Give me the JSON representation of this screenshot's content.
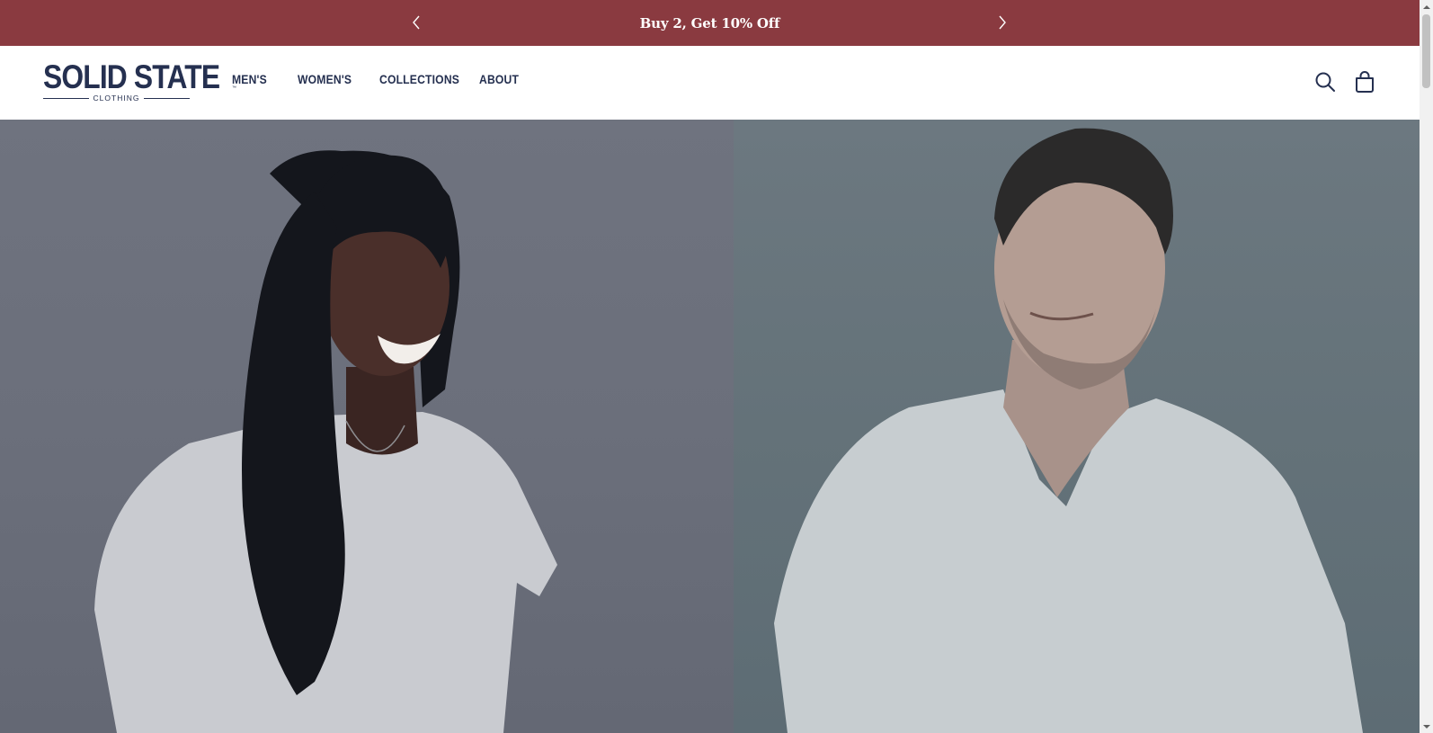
{
  "announcement": {
    "message": "Buy 2, Get 10% Off",
    "prev_icon": "chevron-left-icon",
    "next_icon": "chevron-right-icon",
    "background": "#8a3a40"
  },
  "header": {
    "logo": {
      "wordmark": "SOLID STATE",
      "subtitle": "CLOTHING",
      "mark": "™"
    },
    "nav": [
      {
        "label": "MEN'S"
      },
      {
        "label": "WOMEN'S"
      },
      {
        "label": "COLLECTIONS"
      },
      {
        "label": "ABOUT"
      }
    ],
    "icons": {
      "search": "search-icon",
      "cart": "shopping-bag-icon"
    },
    "brand_color": "#253050"
  },
  "hero": {
    "left_image": "woman-in-white-tee-photo",
    "right_image": "man-in-white-vneck-photo"
  }
}
